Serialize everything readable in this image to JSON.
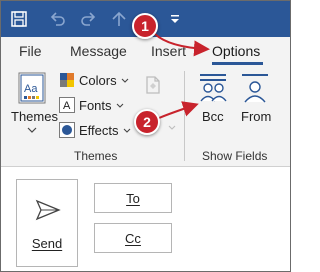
{
  "colors": {
    "titlebar": "#2b5797",
    "ribbon": "#f3f3f3",
    "accent": "#2b5797",
    "callout": "#c8232c"
  },
  "quick_access": [
    {
      "icon": "save-icon"
    },
    {
      "icon": "undo-icon"
    },
    {
      "icon": "redo-icon"
    },
    {
      "icon": "up-arrow-icon"
    },
    {
      "icon": "customize-toolbar-icon"
    }
  ],
  "tabs": [
    {
      "label": "File"
    },
    {
      "label": "Message"
    },
    {
      "label": "Insert"
    },
    {
      "label": "Options",
      "active": true
    }
  ],
  "ribbon": {
    "themes_group": {
      "themes_label": "Themes",
      "colors_label": "Colors",
      "fonts_label": "Fonts",
      "effects_label": "Effects",
      "group_label": "Themes"
    },
    "show_fields_group": {
      "bcc_label": "Bcc",
      "from_label": "From",
      "group_label": "Show Fields"
    }
  },
  "compose": {
    "send_label": "Send",
    "to_label": "To",
    "cc_label": "Cc"
  },
  "callouts": [
    {
      "number": "1"
    },
    {
      "number": "2"
    }
  ]
}
